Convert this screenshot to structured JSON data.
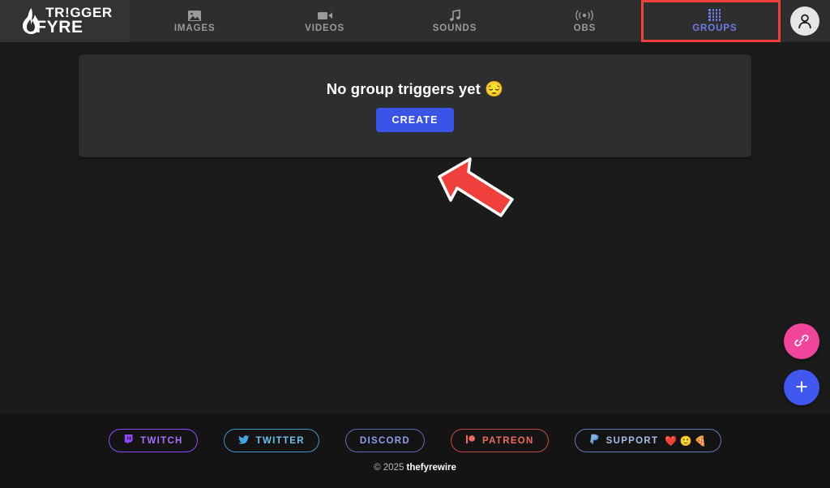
{
  "brand": {
    "icon": "flame-icon",
    "line1": "TR!GGER",
    "line2": "FYRE"
  },
  "nav": {
    "items": [
      {
        "label": "IMAGES",
        "icon": "image-icon",
        "active": false
      },
      {
        "label": "VIDEOS",
        "icon": "video-camera-icon",
        "active": false
      },
      {
        "label": "SOUNDS",
        "icon": "music-note-icon",
        "active": false
      },
      {
        "label": "OBS",
        "icon": "broadcast-icon",
        "active": false
      },
      {
        "label": "GROUPS",
        "icon": "grid-dots-icon",
        "active": true
      }
    ],
    "avatar_icon": "user-avatar-icon",
    "active_color": "#6c7ce8",
    "inactive_color": "#9a9a9a"
  },
  "annotations": {
    "highlight_box": {
      "target": "GROUPS",
      "color": "#f0403c"
    },
    "arrow": {
      "target": "CREATE",
      "color": "#f0403c",
      "direction": "up-left"
    }
  },
  "main": {
    "empty_state": {
      "message": "No group triggers yet 😔",
      "create_label": "CREATE",
      "create_color": "#3b54e8"
    }
  },
  "fab": {
    "link": {
      "icon": "link-icon",
      "color": "#f0459b"
    },
    "add": {
      "icon": "plus-icon",
      "color": "#4057f0"
    }
  },
  "footer": {
    "social": [
      {
        "label": "TWITCH",
        "icon": "twitch-icon",
        "color": "#9146ff",
        "emojis": ""
      },
      {
        "label": "TWITTER",
        "icon": "twitter-icon",
        "color": "#45a5e0",
        "emojis": ""
      },
      {
        "label": "DISCORD",
        "icon": "",
        "color": "#7d8ce0",
        "emojis": ""
      },
      {
        "label": "PATREON",
        "icon": "patreon-icon",
        "color": "#e5544a",
        "emojis": ""
      },
      {
        "label": "SUPPORT",
        "icon": "paypal-icon",
        "color": "#7d9ce0",
        "emojis": "❤️ 🙂 🍕"
      }
    ],
    "copyright_prefix": "© 2025 ",
    "copyright_name": "thefyrewire"
  }
}
